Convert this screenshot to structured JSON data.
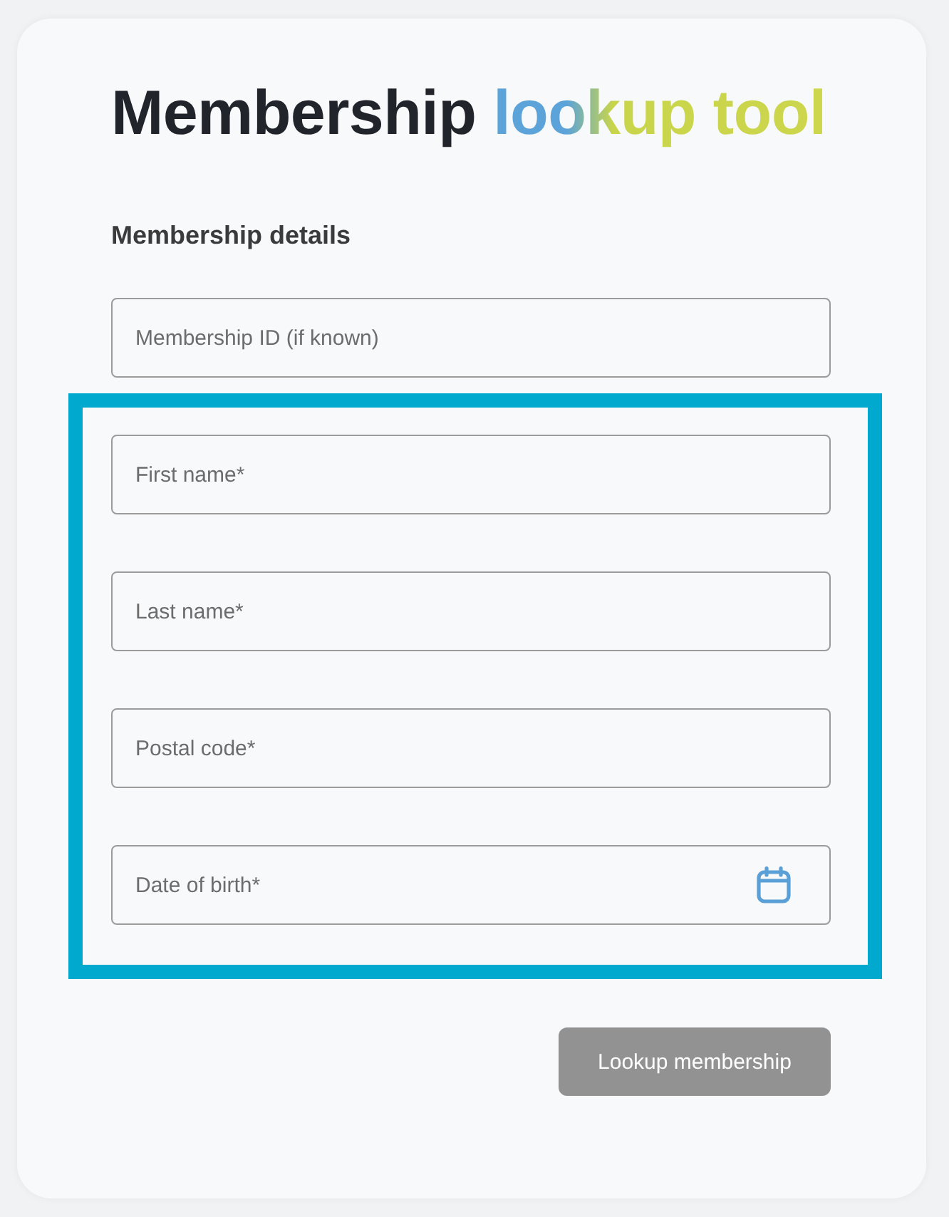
{
  "title": {
    "text": "Membership",
    "highlight": "lookup tool"
  },
  "section_heading": "Membership details",
  "fields": [
    {
      "placeholder": "Membership ID (if known)",
      "kind": "text"
    }
  ],
  "highlighted_group": {
    "fields": [
      {
        "placeholder": "First name*",
        "kind": "text"
      },
      {
        "placeholder": "Last name*",
        "kind": "text"
      },
      {
        "placeholder": "Postal code*",
        "kind": "text"
      },
      {
        "placeholder": "Date of birth*",
        "kind": "date"
      }
    ]
  },
  "button": {
    "label": "Lookup membership",
    "disabled": true
  }
}
